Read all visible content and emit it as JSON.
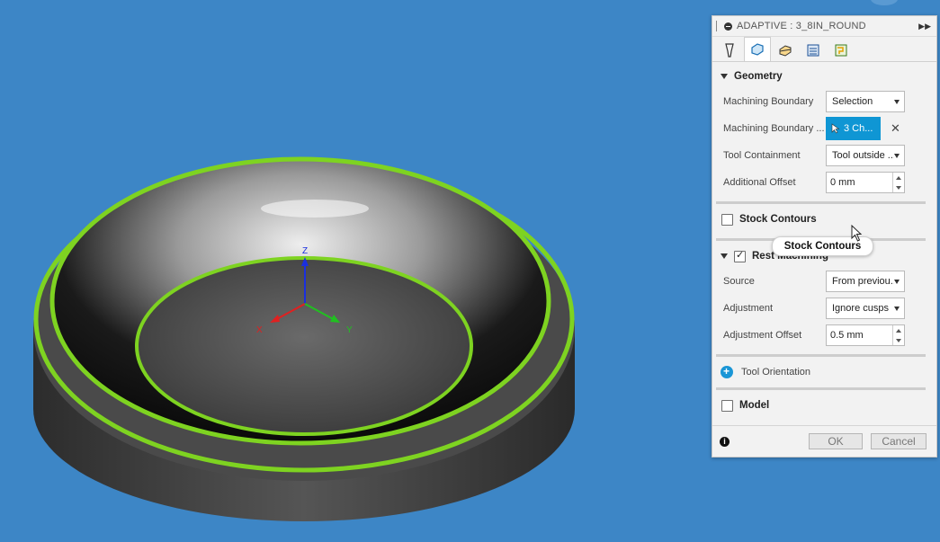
{
  "panel": {
    "title": "ADAPTIVE : 3_8IN_ROUND",
    "tabs": [
      {
        "icon": "tool-icon",
        "active": false
      },
      {
        "icon": "geometry-icon",
        "active": true
      },
      {
        "icon": "heights-icon",
        "active": false
      },
      {
        "icon": "passes-icon",
        "active": false
      },
      {
        "icon": "linking-icon",
        "active": false
      }
    ],
    "geometry": {
      "header": "Geometry",
      "machining_boundary_label": "Machining Boundary",
      "machining_boundary_value": "Selection",
      "boundary_selection_label": "Machining Boundary ...",
      "boundary_selection_value": "3 Ch...",
      "tool_containment_label": "Tool Containment",
      "tool_containment_value": "Tool outside ...",
      "additional_offset_label": "Additional Offset",
      "additional_offset_value": "0 mm"
    },
    "stock_contours": {
      "label": "Stock Contours",
      "checked": false
    },
    "rest_machining": {
      "label": "Rest Machining",
      "checked": true,
      "source_label": "Source",
      "source_value": "From previou...",
      "adjustment_label": "Adjustment",
      "adjustment_value": "Ignore cusps",
      "adjustment_offset_label": "Adjustment Offset",
      "adjustment_offset_value": "0.5 mm"
    },
    "tool_orientation": {
      "label": "Tool Orientation"
    },
    "model": {
      "label": "Model",
      "checked": false
    },
    "footer": {
      "ok_label": "OK",
      "cancel_label": "Cancel"
    }
  },
  "tooltip": {
    "text": "Stock Contours"
  },
  "viewport": {
    "axis_labels": {
      "x": "X",
      "y": "Y",
      "z": "Z"
    },
    "colors": {
      "background": "#3d86c6",
      "selection": "#7ed321"
    }
  }
}
